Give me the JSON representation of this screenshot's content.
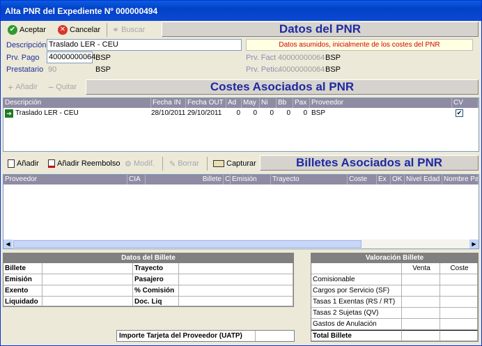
{
  "window": {
    "title": "Alta PNR del Expediente Nº 000000494"
  },
  "toolbar": {
    "accept": "Aceptar",
    "cancel": "Cancelar",
    "search": "Buscar"
  },
  "pnr": {
    "section_title": "Datos del PNR",
    "notice": "Datos asumidos, inicialmente de los costes del PNR",
    "desc_label": "Descripción",
    "desc_value": "Traslado LER - CEU",
    "prv_pago_label": "Prv. Pago",
    "prv_pago_value": "40000000064",
    "prv_pago_name": "BSP",
    "prestatario_label": "Prestatario",
    "prestatario_value": "90",
    "prestatario_name": "BSP",
    "prv_fact_label": "Prv. Fact",
    "prv_fact_value": "40000000064",
    "prv_fact_name": "BSP",
    "prv_petic_label": "Prv. Petic.",
    "prv_petic_value": "40000000064",
    "prv_petic_name": "BSP"
  },
  "costes": {
    "add": "Añadir",
    "remove": "Quitar",
    "section_title": "Costes Asociados al PNR",
    "columns": [
      "Descripción",
      "Fecha IN",
      "Fecha OUT",
      "Ad",
      "May",
      "Ni",
      "Bb",
      "Pax",
      "Proveedor",
      "CV"
    ],
    "rows": [
      {
        "desc": "Traslado LER - CEU",
        "fecha_in": "28/10/2011",
        "fecha_out": "29/10/2011",
        "ad": "0",
        "may": "0",
        "ni": "0",
        "bb": "0",
        "pax": "0",
        "proveedor": "BSP",
        "cv": true
      }
    ]
  },
  "billetes": {
    "add": "Añadir",
    "add_reimb": "Añadir Reembolso",
    "modify": "Modif.",
    "delete": "Borrar",
    "capture": "Capturar",
    "section_title": "Billetes Asociados al PNR",
    "columns": [
      "Proveedor",
      "CIA",
      "Billete",
      "C",
      "Emisión",
      "Trayecto",
      "Coste",
      "Ex",
      "OK",
      "Nivel Edad",
      "Nombre Pa"
    ]
  },
  "datos_billete": {
    "title": "Datos del Billete",
    "billete": "Billete",
    "trayecto": "Trayecto",
    "emision": "Emisión",
    "pasajero": "Pasajero",
    "exento": "Exento",
    "comision": "% Comisión",
    "liquidado": "Liquidado",
    "doc_liq": "Doc. Liq"
  },
  "uatp": {
    "label": "Importe Tarjeta del Proveedor (UATP)"
  },
  "valoracion": {
    "title": "Valoración Billete",
    "col_venta": "Venta",
    "col_coste": "Coste",
    "rows": [
      "Comisionable",
      "Cargos por Servicio (SF)",
      "Tasas 1 Exentas (RS / RT)",
      "Tasas 2 Sujetas (QV)",
      "Gastos de Anulación"
    ],
    "total": "Total Billete"
  }
}
